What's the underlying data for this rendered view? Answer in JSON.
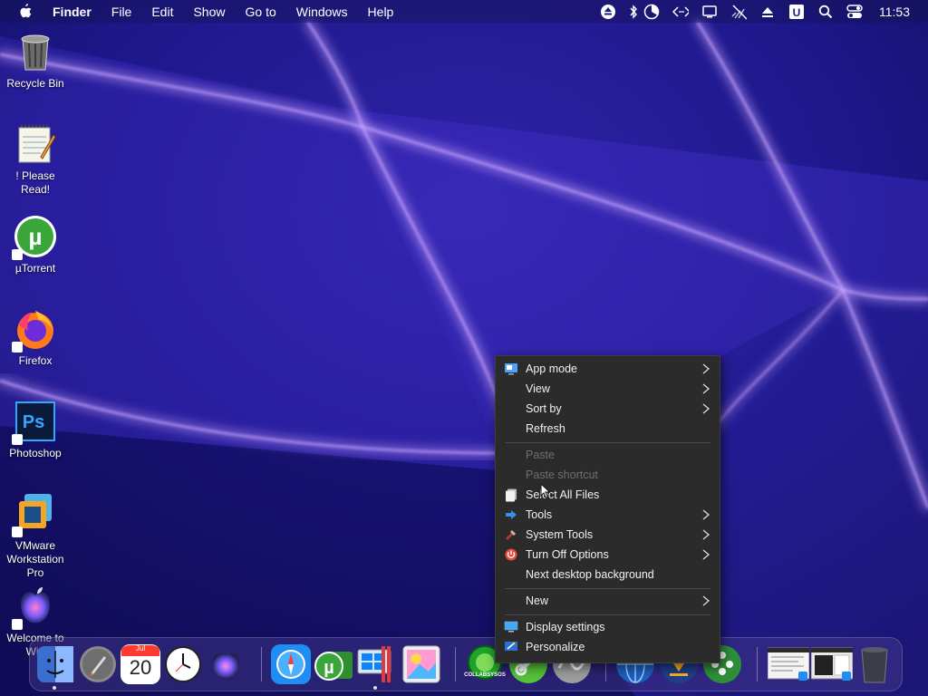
{
  "menubar": {
    "app_name": "Finder",
    "menus": [
      "File",
      "Edit",
      "Show",
      "Go to",
      "Windows",
      "Help"
    ],
    "clock": "11:53",
    "status_icons": [
      "eject-icon",
      "bluetooth-icon",
      "battery-pie-icon",
      "code-icon",
      "display-icon",
      "mute-icon",
      "eject-alt-icon",
      "u-badge-icon",
      "search-icon",
      "control-center-icon"
    ]
  },
  "desktop": {
    "icons": [
      {
        "label": "Recycle Bin",
        "icon": "recycle-bin-icon"
      },
      {
        "label": "! Please Read!",
        "icon": "notepad-icon"
      },
      {
        "label": "µTorrent",
        "icon": "utorrent-icon"
      },
      {
        "label": "Firefox",
        "icon": "firefox-icon"
      },
      {
        "label": "Photoshop",
        "icon": "photoshop-icon"
      },
      {
        "label": "VMware Workstation Pro",
        "icon": "vmware-icon"
      },
      {
        "label": "Welcome to Win",
        "icon": "welcome-icon"
      }
    ]
  },
  "context_menu": {
    "items": [
      {
        "label": "App mode",
        "icon": "app-mode-icon",
        "submenu": true,
        "disabled": false
      },
      {
        "label": "View",
        "icon": "",
        "submenu": true,
        "disabled": false
      },
      {
        "label": "Sort by",
        "icon": "",
        "submenu": true,
        "disabled": false
      },
      {
        "label": "Refresh",
        "icon": "",
        "submenu": false,
        "disabled": false
      },
      {
        "label": "Paste",
        "icon": "",
        "submenu": false,
        "disabled": true
      },
      {
        "label": "Paste shortcut",
        "icon": "",
        "submenu": false,
        "disabled": true
      },
      {
        "label": "Select All Files",
        "icon": "select-all-icon",
        "submenu": false,
        "disabled": false
      },
      {
        "label": "Tools",
        "icon": "tools-arrow-icon",
        "submenu": true,
        "disabled": false
      },
      {
        "label": "System Tools",
        "icon": "system-tools-icon",
        "submenu": true,
        "disabled": false
      },
      {
        "label": "Turn Off Options",
        "icon": "power-icon",
        "submenu": true,
        "disabled": false
      },
      {
        "label": "Next desktop background",
        "icon": "",
        "submenu": false,
        "disabled": false
      },
      {
        "label": "New",
        "icon": "",
        "submenu": true,
        "disabled": false
      },
      {
        "label": "Display settings",
        "icon": "display-settings-icon",
        "submenu": false,
        "disabled": false
      },
      {
        "label": "Personalize",
        "icon": "personalize-icon",
        "submenu": false,
        "disabled": false
      }
    ]
  },
  "dock": {
    "calendar_month": "Jul",
    "calendar_day": "20",
    "collab_label": "COLLABSYSOS",
    "items": [
      "finder-icon",
      "launchpad-icon",
      "calendar-icon",
      "clock-icon",
      "siri-icon",
      "safari-icon",
      "utorrent-folder-icon",
      "windows-pc-icon",
      "photo-app-icon",
      "collabsysos-icon",
      "link-icon",
      "network-icon",
      "globe-icon",
      "download-icon",
      "plant-icon",
      "window-preview-icon",
      "window-preview-icon",
      "trash-icon"
    ]
  },
  "colors": {
    "menu_bg": "#2b2b2b",
    "menu_text": "#f2f2f2",
    "menu_disabled": "#6e6e6e",
    "wallpaper_base": "#14105e",
    "wallpaper_glow": "#b78cff"
  }
}
